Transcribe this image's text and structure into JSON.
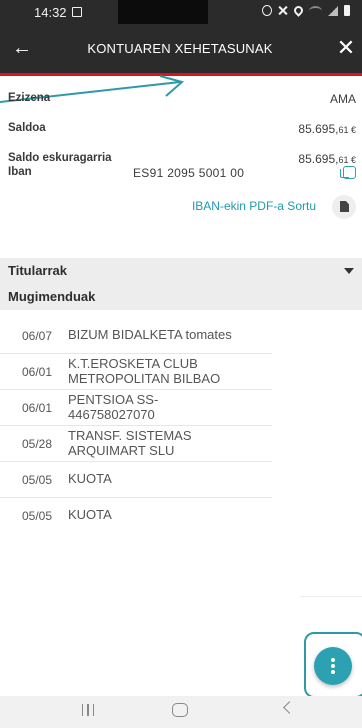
{
  "status_bar": {
    "time": "14:32"
  },
  "header": {
    "title": "KONTUAREN XEHETASUNAK",
    "back_icon": "arrow-left-icon",
    "close_icon": "close-icon",
    "bg_color": "#2b2b2b",
    "accent_color": "#d8151c"
  },
  "details": {
    "name": {
      "label": "Ezizena",
      "value": "AMA"
    },
    "balance": {
      "label": "Saldoa",
      "main": "85.695,",
      "decimals": "61 €"
    },
    "available": {
      "label": "Saldo eskuragarria",
      "main": "85.695,",
      "decimals": "61 €"
    },
    "iban": {
      "label": "Iban",
      "value": "ES91 2095 5001 00"
    },
    "pdf_link": "IBAN-ekin PDF-a Sortu"
  },
  "sections": {
    "holders": "Titularrak",
    "movements": "Mugimenduak"
  },
  "movements": [
    {
      "date": "06/07",
      "desc": "BIZUM BIDALKETA tomates"
    },
    {
      "date": "06/01",
      "desc_line1": "K.T.EROSKETA CLUB",
      "desc_line2": "METROPOLITAN BILBAO"
    },
    {
      "date": "06/01",
      "desc_line1": "PENTSIOA SS-",
      "desc_line2": "446758027070"
    },
    {
      "date": "05/28",
      "desc_line1": "TRANSF. SISTEMAS",
      "desc_line2": "ARQUIMART SLU"
    },
    {
      "date": "05/05",
      "desc": "KUOTA"
    },
    {
      "date": "05/05",
      "desc": "KUOTA"
    }
  ],
  "colors": {
    "accent": "#2ba1b2",
    "link": "#1e9aae"
  }
}
